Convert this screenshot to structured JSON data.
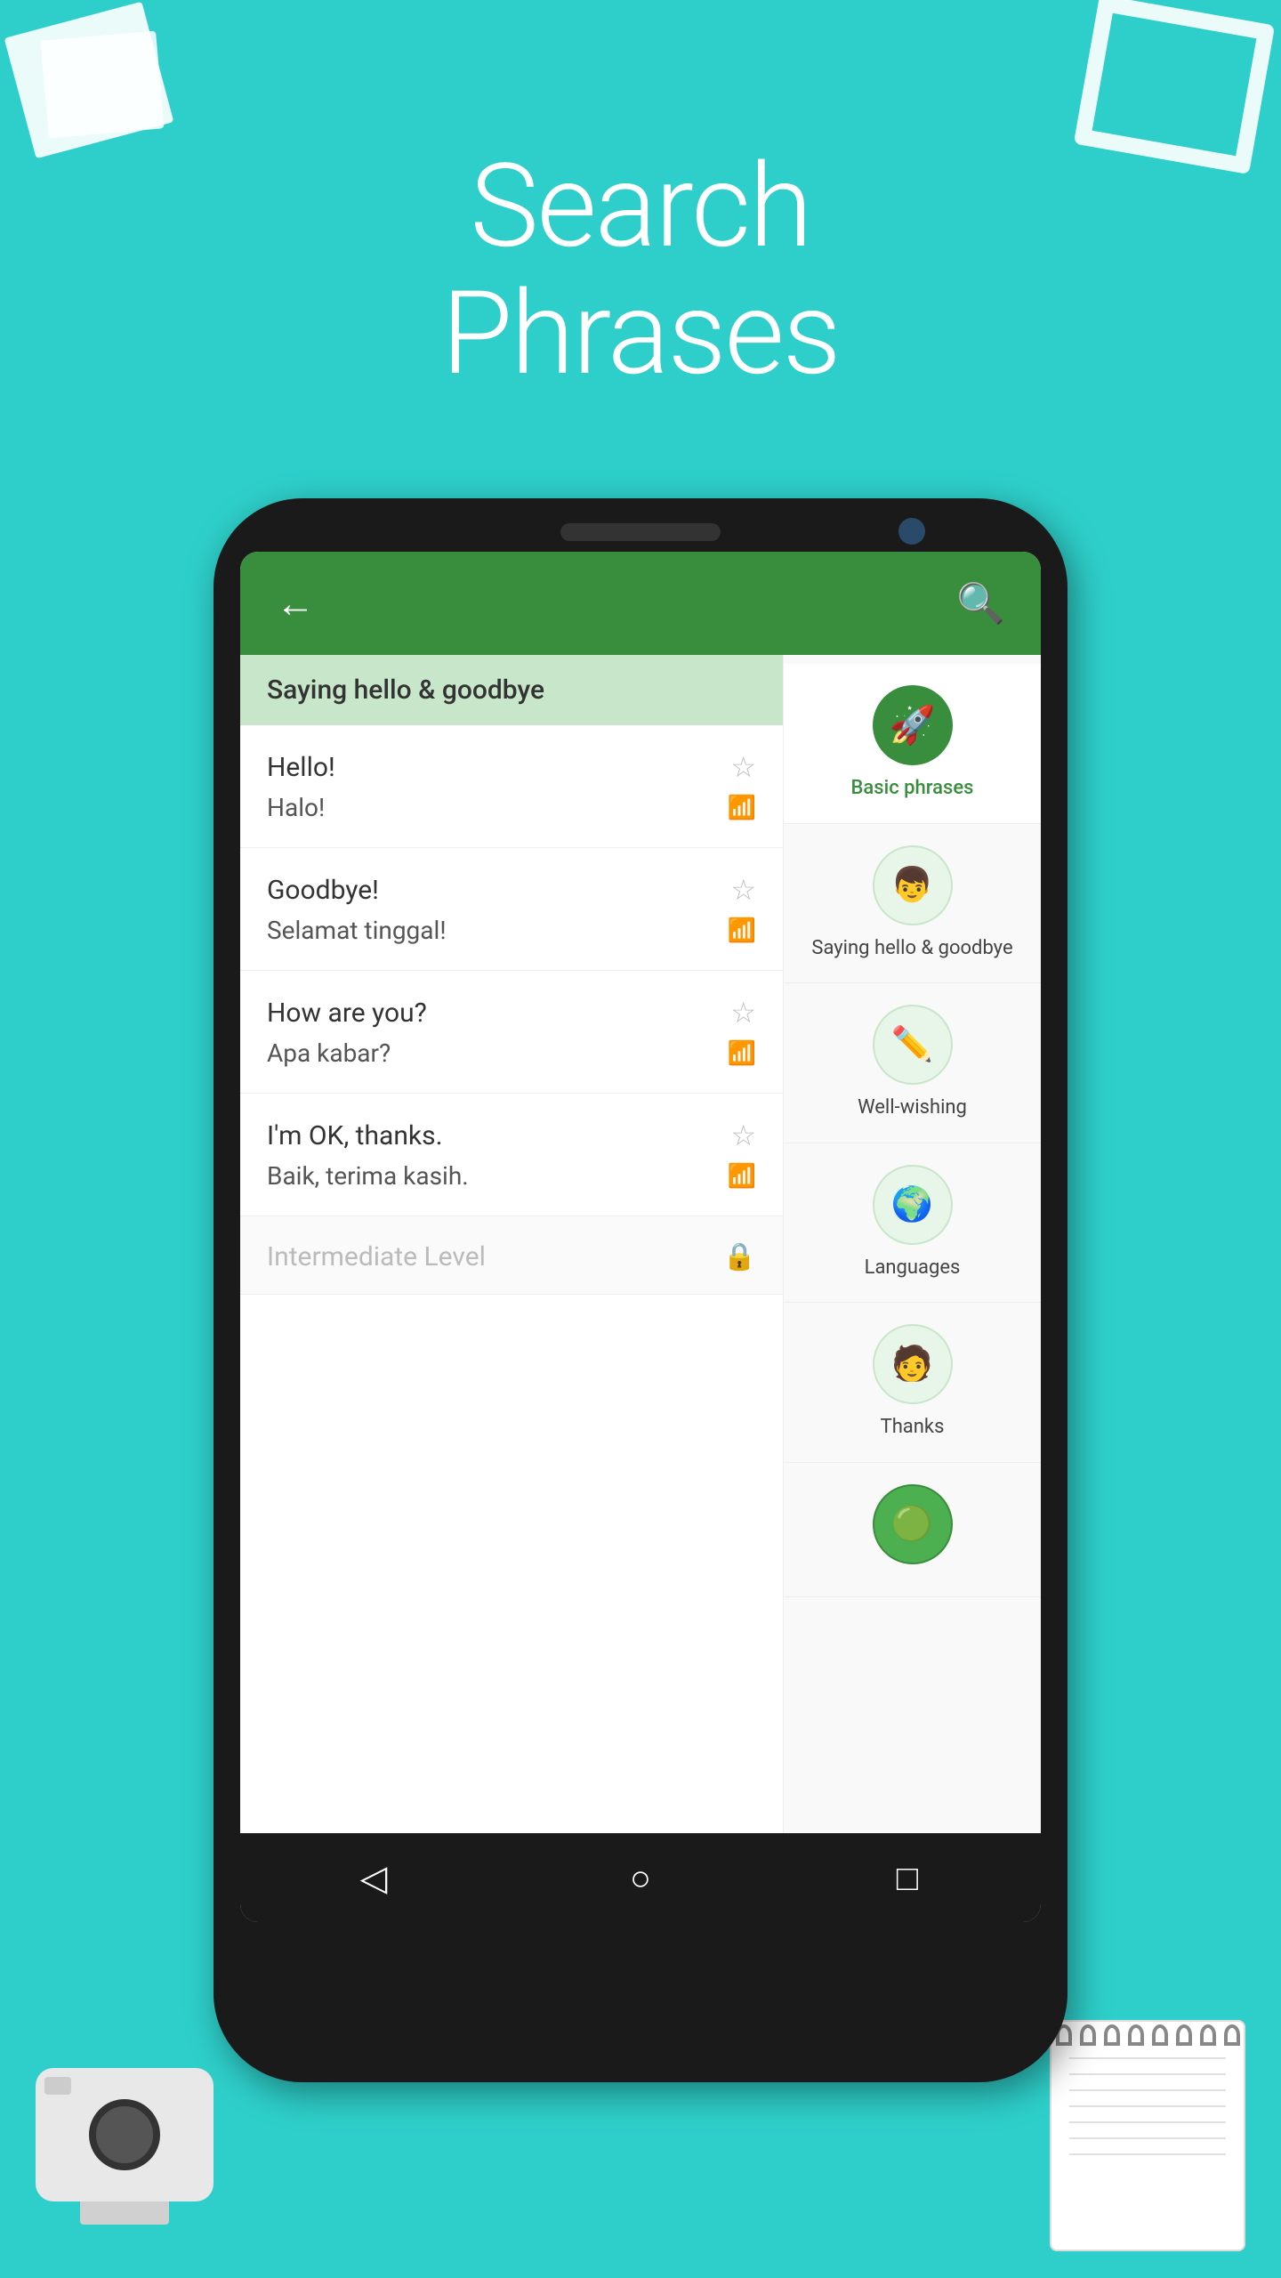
{
  "background_color": "#2ECFCA",
  "title": {
    "line1": "Search",
    "line2": "Phrases"
  },
  "app_bar": {
    "back_icon": "←",
    "search_icon": "🔍"
  },
  "category_header": {
    "label": "Saying hello & goodbye"
  },
  "phrases": [
    {
      "english": "Hello!",
      "translation": "Halo!",
      "starred": false
    },
    {
      "english": "Goodbye!",
      "translation": "Selamat tinggal!",
      "starred": false
    },
    {
      "english": "How are you?",
      "translation": "Apa kabar?",
      "starred": false
    },
    {
      "english": "I'm OK, thanks.",
      "translation": "Baik, terima kasih.",
      "starred": false
    }
  ],
  "locked_item": {
    "label": "Intermediate Level",
    "icon": "🔒"
  },
  "sidebar_items": [
    {
      "id": "basic-phrases",
      "label": "Basic phrases",
      "emoji": "🚀",
      "active": true,
      "bg": "#388E3C"
    },
    {
      "id": "saying-hello",
      "label": "Saying hello & goodbye",
      "emoji": "👦",
      "active": false,
      "bg": "#e8f5e9"
    },
    {
      "id": "well-wishing",
      "label": "Well-wishing",
      "emoji": "✏️",
      "active": false,
      "bg": "#e8f5e9"
    },
    {
      "id": "languages",
      "label": "Languages",
      "emoji": "🌍",
      "active": false,
      "bg": "#e8f5e9"
    },
    {
      "id": "thanks",
      "label": "Thanks",
      "emoji": "🧑",
      "active": false,
      "bg": "#e8f5e9"
    },
    {
      "id": "more",
      "label": "",
      "emoji": "🟢",
      "active": false,
      "bg": "#e8f5e9"
    }
  ],
  "bottom_nav": {
    "back": "◁",
    "home": "○",
    "recent": "□"
  }
}
